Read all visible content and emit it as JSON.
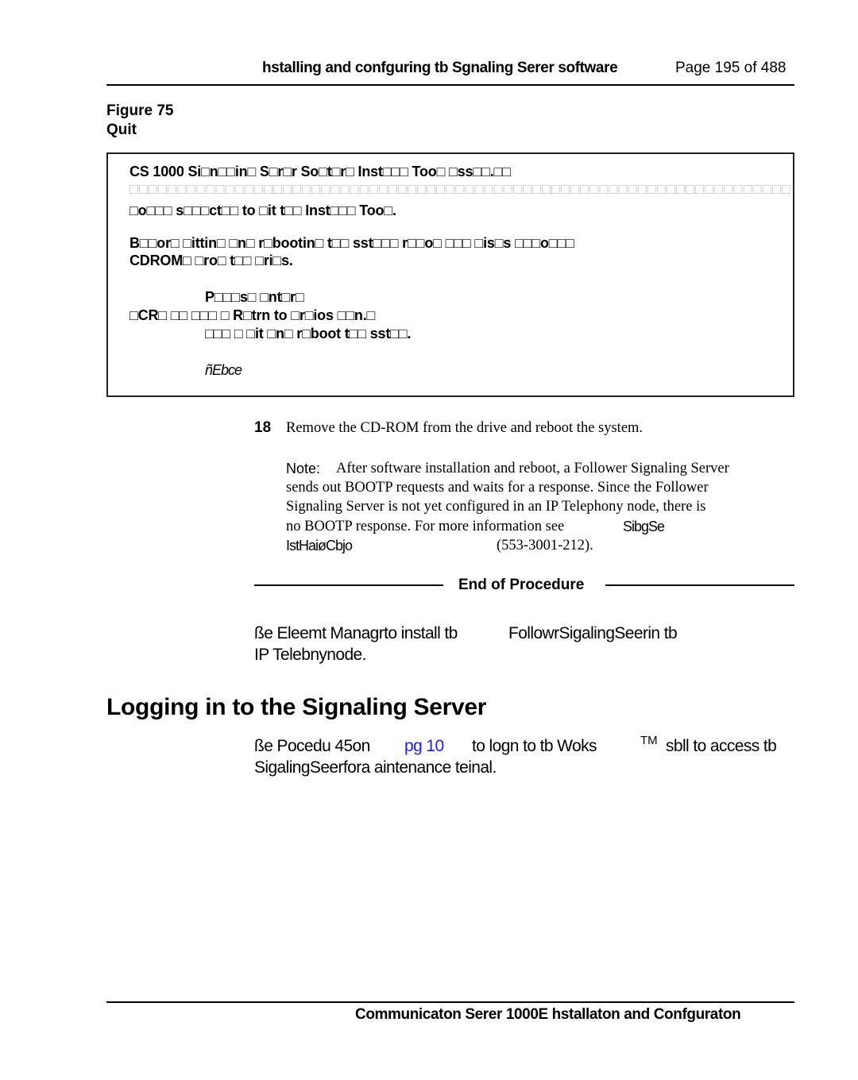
{
  "header": {
    "section_title": "hstalling and confguring tb Sgnaling Serer software",
    "page_label": "Page 195 of 488"
  },
  "figure": {
    "number": "Figure 75",
    "caption": "Quit"
  },
  "screen": {
    "line1": "CS 1000 Si□n□□in□ S□r□r So□t□r□ Inst□□□ Too□ □ss□□.□□",
    "line2": "□□□□□□□□□□□□□□□□□□□□□□□□□□□□□□□□□□□□□□□□□□□□□□□□□□□□□□□□□□□□□□□□□□□□□",
    "line3": "□o□□□ s□□□ct□□ to □it t□□ Inst□□□ Too□.",
    "line4": "B□□or□ □ittin□ □n□ r□bootin□ t□□ sst□□□ r□□o□ □□□ □is□s □□□o□□□",
    "line5": "CDROM□ □ro□ t□□ □ri□s.",
    "line6": "P□□□s□ □nt□r□",
    "line7": "□CR□ □□ □□□ □ R□trn to □r□ios □□n.□",
    "line8": "□□□ □ □it □n□ r□boot t□□ sst□□.",
    "line9": "ñEbce"
  },
  "step": {
    "number": "18",
    "text": "Remove the CD-ROM from the     drive and reboot the system."
  },
  "note": {
    "label": "Note:",
    "line1": "After software installation and reboot, a Follower Signaling Server",
    "line2": "sends out BOOTP requests and waits for a response. Since the Follower",
    "line3": "Signaling Server is not yet configured in an IP Telephony node, there is",
    "line4": "no BOOTP response. For more information see",
    "ref_title_a": "SibgSe",
    "ref_title_b": "IstHaiøCbjo",
    "ref_doc": "(553-3001-212)."
  },
  "end_of_procedure": "End of Procedure",
  "para1": {
    "line1a": "ße Eleemt Managrto install tb",
    "line1b": "FollowrSigalingSeerin tb",
    "line2": "IP Telebnynode."
  },
  "section": {
    "heading": "Logging in to the Signaling Server"
  },
  "para2": {
    "part1": "ße Pocedu 45on",
    "link": "pg 10",
    "part2": "to logn to tb Woks",
    "tm": "TM",
    "part3": "sbll to access tb",
    "line2": "SigalingSeerfora aintenance teinal."
  },
  "footer": {
    "text": "Communicaton Serer 1000E     hstallaton and Confguraton"
  },
  "colors": {
    "link": "#1a1aff",
    "dim_glyph": "#bdbdbd"
  }
}
